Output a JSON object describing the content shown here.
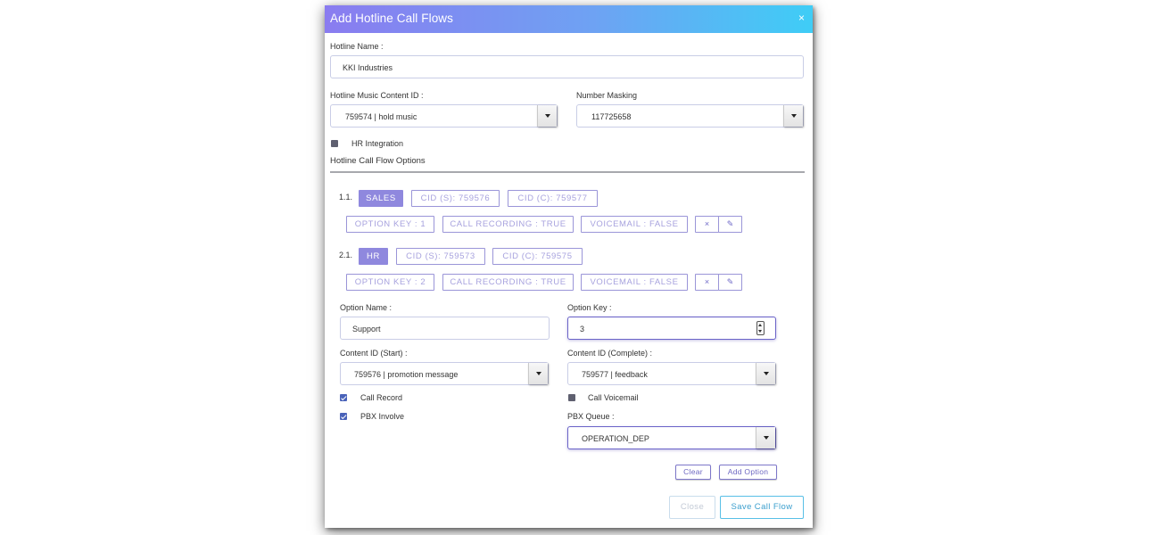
{
  "modal": {
    "title": "Add Hotline Call Flows",
    "close_glyph": "×"
  },
  "hotline_name": {
    "label": "Hotline Name :",
    "value": "KKI Industries"
  },
  "music_content": {
    "label": "Hotline Music Content ID :",
    "value": "759574 | hold music"
  },
  "number_masking": {
    "label": "Number Masking",
    "value": "117725658"
  },
  "hr_integration": {
    "label": "HR Integration",
    "checked": false
  },
  "options_heading": "Hotline Call Flow Options",
  "flows": [
    {
      "index": "1.1.",
      "name": "SALES",
      "cid_start": "CID (S): 759576",
      "cid_complete": "CID (C): 759577",
      "option_key": "OPTION KEY : 1",
      "call_recording": "CALL RECORDING : TRUE",
      "voicemail": "VOICEMAIL : FALSE",
      "delete_glyph": "×",
      "edit_glyph": "✎"
    },
    {
      "index": "2.1.",
      "name": "HR",
      "cid_start": "CID (S): 759573",
      "cid_complete": "CID (C): 759575",
      "option_key": "OPTION KEY : 2",
      "call_recording": "CALL RECORDING : TRUE",
      "voicemail": "VOICEMAIL : FALSE",
      "delete_glyph": "×",
      "edit_glyph": "✎"
    }
  ],
  "form": {
    "option_name": {
      "label": "Option Name :",
      "value": "Support"
    },
    "option_key": {
      "label": "Option Key :",
      "value": "3"
    },
    "content_start": {
      "label": "Content ID (Start) :",
      "value": "759576 | promotion message"
    },
    "content_complete": {
      "label": "Content ID (Complete) :",
      "value": "759577 | feedback"
    },
    "call_record": {
      "label": "Call Record",
      "checked": true
    },
    "call_voicemail": {
      "label": "Call Voicemail",
      "checked": false
    },
    "pbx_involve": {
      "label": "PBX Involve",
      "checked": true
    },
    "pbx_queue": {
      "label": "PBX Queue :",
      "value": "OPERATION_DEP"
    },
    "clear_label": "Clear",
    "add_option_label": "Add Option"
  },
  "footer": {
    "close_label": "Close",
    "save_label": "Save Call Flow"
  },
  "colors": {
    "header_gradient_start": "#8a7cf0",
    "header_gradient_end": "#3fcdf6",
    "tag_accent": "#8f88de",
    "save_accent": "#3b9fce"
  }
}
